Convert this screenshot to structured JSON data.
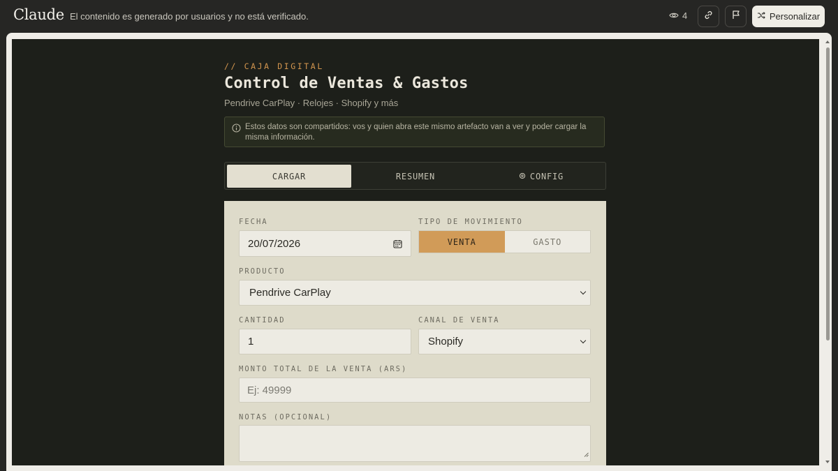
{
  "topbar": {
    "brand": "Claude",
    "notice": "El contenido es generado por usuarios y no está verificado.",
    "views": "4",
    "customize_label": "Personalizar"
  },
  "app": {
    "eyebrow": "// CAJA DIGITAL",
    "title": "Control de Ventas & Gastos",
    "subtitle": "Pendrive CarPlay · Relojes · Shopify y más",
    "info": "Estos datos son compartidos: vos y quien abra este mismo artefacto van a ver y poder cargar la misma información.",
    "tabs": [
      {
        "label": "CARGAR"
      },
      {
        "label": "RESUMEN"
      },
      {
        "label": "CONFIG"
      }
    ]
  },
  "form": {
    "fecha": {
      "label": "FECHA",
      "value": "20/07/2026"
    },
    "tipo": {
      "label": "TIPO DE MOVIMIENTO",
      "options": [
        "VENTA",
        "GASTO"
      ],
      "selected": "VENTA"
    },
    "producto": {
      "label": "PRODUCTO",
      "value": "Pendrive CarPlay"
    },
    "cantidad": {
      "label": "CANTIDAD",
      "value": "1"
    },
    "canal": {
      "label": "CANAL DE VENTA",
      "value": "Shopify"
    },
    "monto": {
      "label": "MONTO TOTAL DE LA VENTA (ARS)",
      "placeholder": "Ej: 49999"
    },
    "notas": {
      "label": "NOTAS (OPCIONAL)",
      "value": ""
    }
  },
  "colors": {
    "accent": "#d19b58",
    "background": "#1d1f1a",
    "panel": "#dedbca"
  },
  "icons": [
    "eye-icon",
    "link-icon",
    "flag-icon",
    "shuffle-icon",
    "info-icon",
    "gear-icon",
    "calendar-icon",
    "chevron-down-icon"
  ]
}
